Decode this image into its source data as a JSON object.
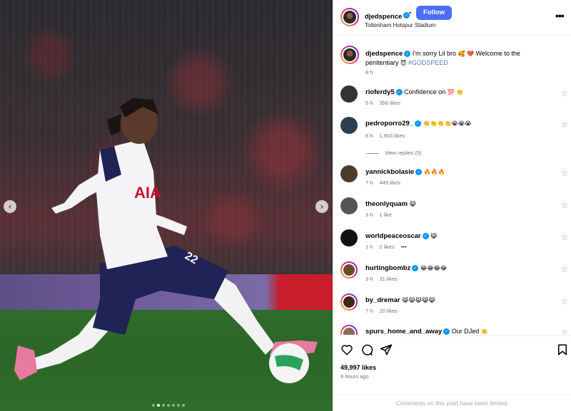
{
  "post": {
    "author": "djedspence",
    "location": "Tottenham Hotspur Stadium",
    "follow_label": "Follow",
    "separator": "•",
    "more_label": "•••",
    "caption": {
      "author": "djedspence",
      "text": "I'm sorry Lil bro",
      "emoji_1": "🥰 💔",
      "text_2": "Welcome to the penitentiary",
      "emoji_2": "😈",
      "hashtag": "#GODSPEED",
      "time": "8 h"
    },
    "likes": "49,997 likes",
    "posted": "8 hours ago",
    "comments_limited": "Comments on this post have been limited.",
    "carousel": {
      "total": 7,
      "active": 1
    },
    "image_text": {
      "sponsor": "AIA",
      "number": "22"
    }
  },
  "comments": [
    {
      "user": "rioferdy5",
      "verified": true,
      "text": "Confidence on",
      "emoji": "💯 👏",
      "time": "5 h",
      "likes": "356 likes"
    },
    {
      "user": "pedroporro29_",
      "verified": true,
      "text": "",
      "emoji": "👏👏👏👏😭😭😭",
      "time": "8 h",
      "likes": "1,903 likes",
      "replies": "View replies (5)"
    },
    {
      "user": "yannickbolasie",
      "verified": true,
      "text": "",
      "emoji": "🔥🔥🔥",
      "time": "7 h",
      "likes": "449 likes"
    },
    {
      "user": "theonlyquam",
      "verified": false,
      "text": "",
      "emoji": "😹",
      "time": "3 h",
      "likes": "1 like"
    },
    {
      "user": "worldpeaceoscar",
      "verified": true,
      "text": "",
      "emoji": "😹",
      "time": "1 h",
      "likes": "2 likes",
      "extra": "•••"
    },
    {
      "user": "hurtingbombz",
      "verified": true,
      "text": "",
      "emoji": "😂😂😂😂",
      "time": "3 h",
      "likes": "31 likes"
    },
    {
      "user": "by_dremar",
      "verified": false,
      "text": "",
      "emoji": "😹😹😹😹😹",
      "time": "7 h",
      "likes": "20 likes"
    },
    {
      "user": "spurs_home_and_away",
      "verified": true,
      "text": "Our DJed",
      "emoji": "👏",
      "time": "",
      "likes": ""
    }
  ],
  "icons": {
    "heart": "heart-outline-icon",
    "comment": "comment-icon",
    "share": "paper-plane-icon",
    "save": "bookmark-icon",
    "prev": "chevron-left-icon",
    "next": "chevron-right-icon"
  },
  "colors": {
    "follow": "#4c6ef5",
    "verified": "#0095f6",
    "hashtag": "#4f7ec7",
    "meta": "#737373"
  }
}
